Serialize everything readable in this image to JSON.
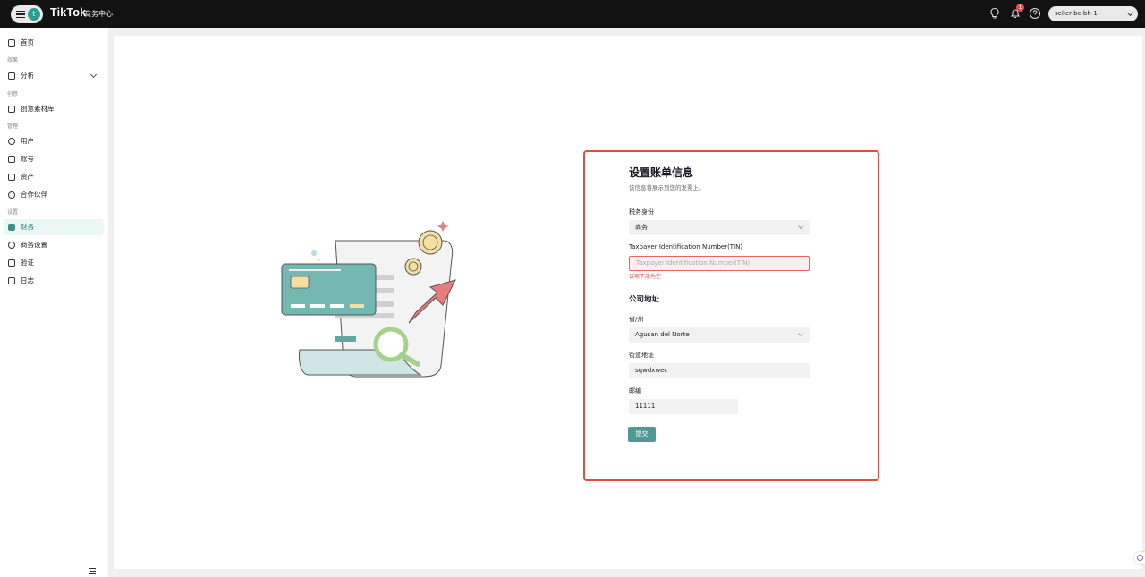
{
  "topbar": {
    "avatar_letter": "t",
    "brand": "TikTok",
    "brand_sub": "商务中心",
    "notification_count": "1",
    "account": "seller-bc-bh-1"
  },
  "sidebar": {
    "home": "首页",
    "section_effect": "效果",
    "analysis": "分析",
    "section_creative": "创意",
    "creative_library": "创意素材库",
    "section_manage": "管理",
    "users": "用户",
    "accounts": "账号",
    "assets": "资产",
    "partners": "合作伙伴",
    "section_settings": "设置",
    "finance": "财务",
    "business_settings": "商务设置",
    "verification": "验证",
    "logs": "日志"
  },
  "form": {
    "title": "设置账单信息",
    "subtitle": "该信息将展示到您的发票上。",
    "tax_identity_label": "税务身份",
    "tax_identity_value": "商务",
    "tin_label": "Taxpayer Identification Number(TIN)",
    "tin_placeholder": "Taxpayer Identification Number(TIN)",
    "tin_error": "该项不能为空",
    "address_section": "公司地址",
    "province_label": "省/州",
    "province_value": "Agusan del Norte",
    "street_label": "街道地址",
    "street_value": "sqwdxwec",
    "postcode_label": "邮编",
    "postcode_value": "11111",
    "submit": "提交"
  },
  "colors": {
    "accent": "#4f9a94",
    "error": "#e04b44",
    "topbar": "#121212"
  }
}
